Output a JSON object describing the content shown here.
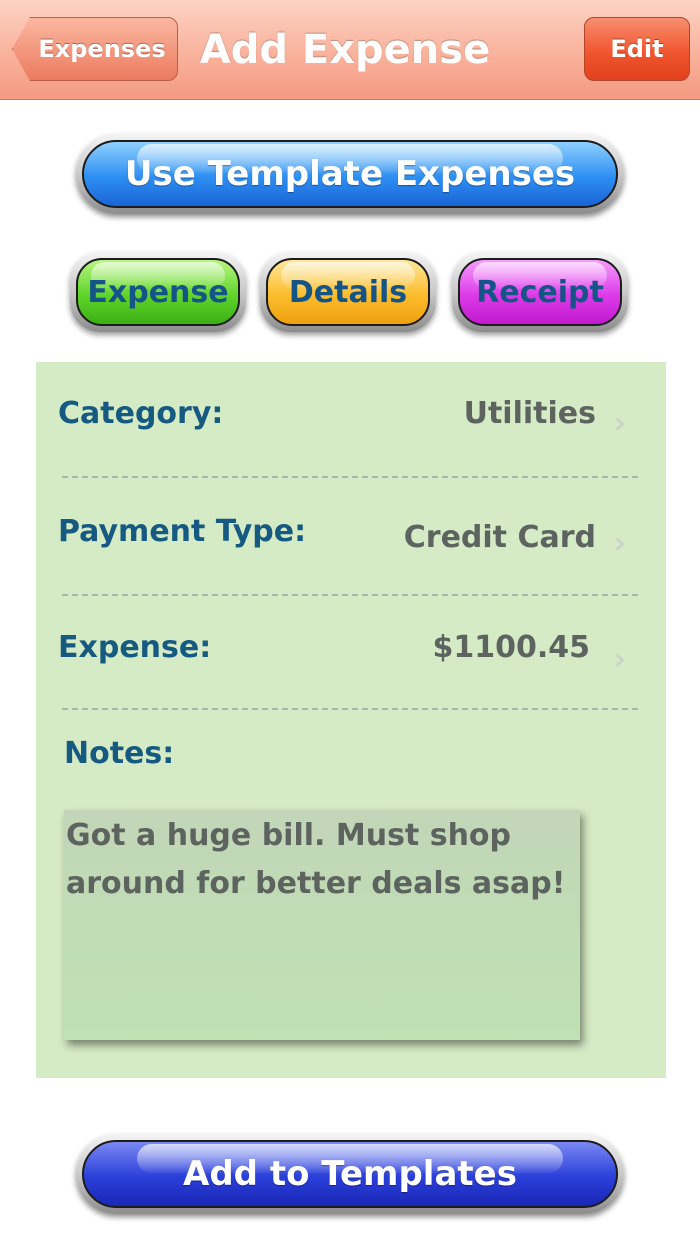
{
  "navbar": {
    "back_label": "Expenses",
    "title": "Add Expense",
    "edit_label": "Edit"
  },
  "template_button": {
    "label": "Use Template Expenses"
  },
  "tabs": [
    {
      "label": "Expense"
    },
    {
      "label": "Details"
    },
    {
      "label": "Receipt"
    }
  ],
  "form": {
    "rows": [
      {
        "label": "Category:",
        "value": "Utilities"
      },
      {
        "label": "Payment Type:",
        "value": "Credit Card"
      },
      {
        "label": "Expense:",
        "value": "$1100.45"
      }
    ],
    "notes_label": "Notes:",
    "notes_value": "Got a huge bill. Must shop around for better deals asap!"
  },
  "add_templates_button": {
    "label": "Add to Templates"
  },
  "colors": {
    "navbar": "#f9b29c",
    "edit_button": "#f0562f",
    "template_button": "#2d8ff2",
    "add_templates_button": "#2a3fd9",
    "tab_expense": "#5fd42a",
    "tab_details": "#fbbd2c",
    "tab_receipt": "#dc3be8",
    "panel": "#d5ebc5",
    "label_text": "#165a82"
  },
  "icons": {
    "row_disclosure": "chevron-right-icon"
  }
}
